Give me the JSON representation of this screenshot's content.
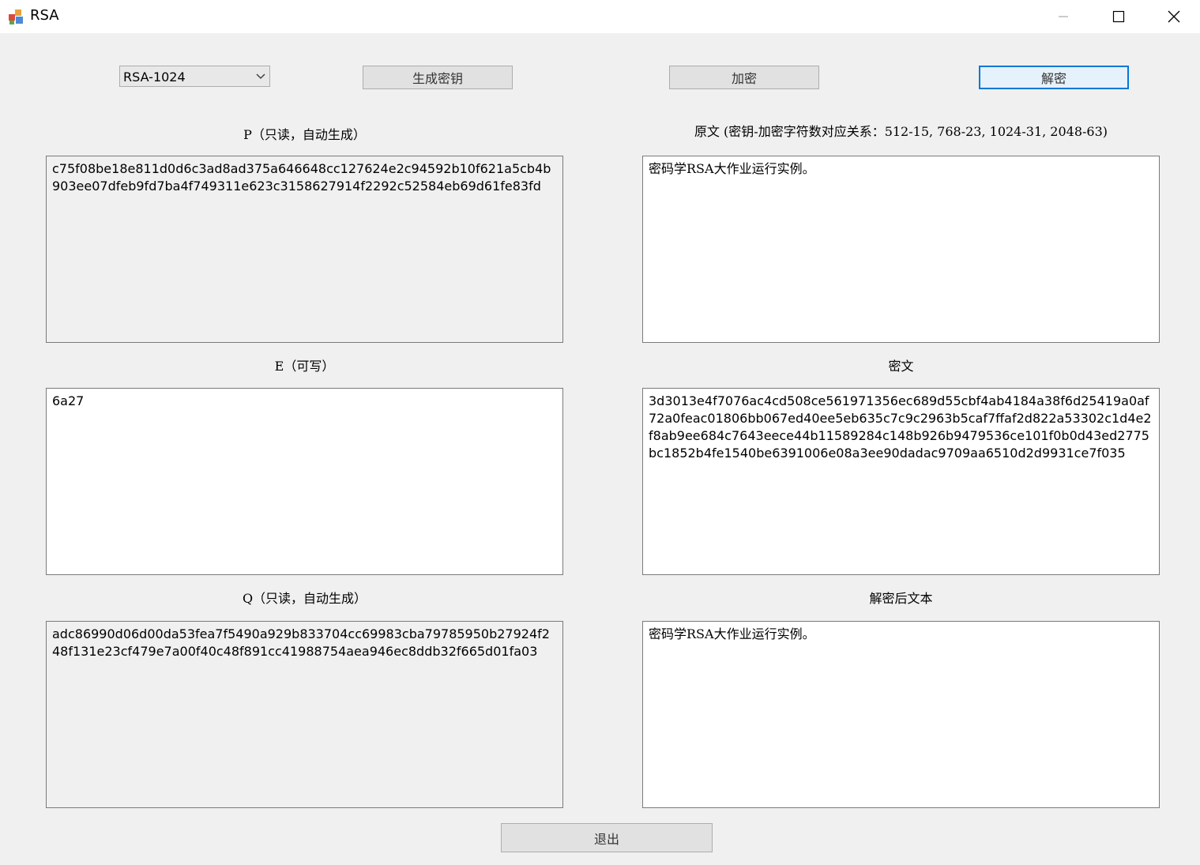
{
  "window": {
    "title": "RSA",
    "app_icon": "rsa-app-icon",
    "controls": [
      "minimize-icon",
      "maximize-icon",
      "close-icon"
    ]
  },
  "toolbar": {
    "key_size_selected": "RSA-1024",
    "generate_label": "生成密钥",
    "encrypt_label": "加密",
    "decrypt_label": "解密"
  },
  "left": {
    "p_label": "P（只读，自动生成）",
    "p_value": "c75f08be18e811d0d6c3ad8ad375a646648cc127624e2c94592b10f621a5cb4b903ee07dfeb9fd7ba4f749311e623c3158627914f2292c52584eb69d61fe83fd",
    "e_label": "E（可写）",
    "e_value": "6a27",
    "q_label": "Q（只读，自动生成）",
    "q_value": "adc86990d06d00da53fea7f5490a929b833704cc69983cba79785950b27924f248f131e23cf479e7a00f40c48f891cc41988754aea946ec8ddb32f665d01fa03"
  },
  "right": {
    "plaintext_label": "原文 (密钥-加密字符数对应关系：512-15, 768-23, 1024-31, 2048-63)",
    "plaintext_value": "密码学RSA大作业运行实例。",
    "ciphertext_label": "密文",
    "ciphertext_value": "3d3013e4f7076ac4cd508ce561971356ec689d55cbf4ab4184a38f6d25419a0af72a0feac01806bb067ed40ee5eb635c7c9c2963b5caf7ffaf2d822a53302c1d4e2f8ab9ee684c7643eece44b11589284c148b926b9479536ce101f0b0d43ed2775bc1852b4fe1540be6391006e08a3ee90dadac9709aa6510d2d9931ce7f035",
    "decrypted_label": "解密后文本",
    "decrypted_value": "密码学RSA大作业运行实例。"
  },
  "footer": {
    "exit_label": "退出"
  },
  "colors": {
    "window_bg": "#f0f0f0",
    "titlebar_bg": "#ffffff",
    "focus_border": "#0078d7"
  }
}
